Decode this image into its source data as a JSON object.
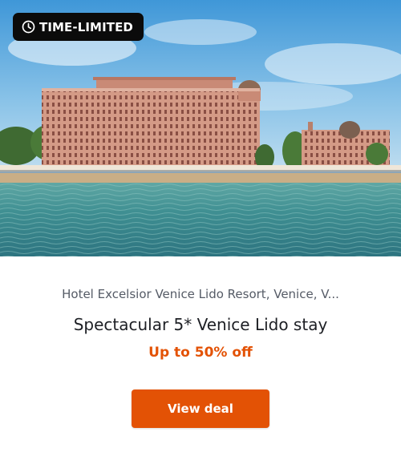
{
  "badge": {
    "label": "TIME-LIMITED",
    "icon": "clock-icon"
  },
  "hero": {
    "icon": "hotel-photo"
  },
  "deal": {
    "location": "Hotel Excelsior Venice Lido Resort, Venice, V...",
    "title": "Spectacular 5* Venice Lido stay",
    "discount": "Up to 50% off",
    "cta_label": "View deal"
  },
  "colors": {
    "accent": "#e35205",
    "badge_bg": "#0b0b0b",
    "text_primary": "#1d1f24",
    "text_secondary": "#555b66"
  }
}
